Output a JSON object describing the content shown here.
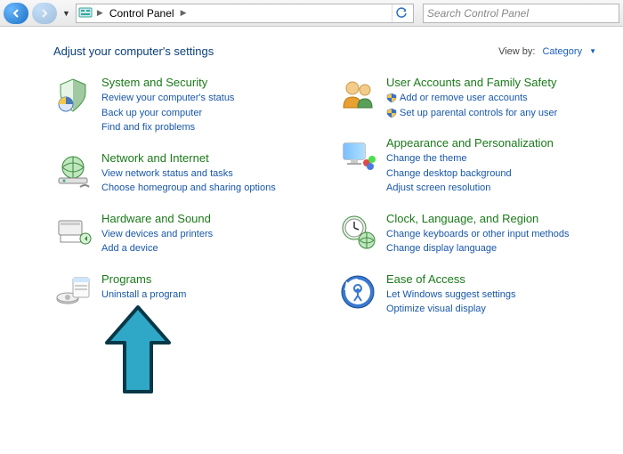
{
  "toolbar": {
    "breadcrumb_item": "Control Panel",
    "search_placeholder": "Search Control Panel"
  },
  "header": {
    "title": "Adjust your computer's settings",
    "viewby_label": "View by:",
    "viewby_value": "Category"
  },
  "left": [
    {
      "title": "System and Security",
      "links": [
        {
          "label": "Review your computer's status"
        },
        {
          "label": "Back up your computer"
        },
        {
          "label": "Find and fix problems"
        }
      ]
    },
    {
      "title": "Network and Internet",
      "links": [
        {
          "label": "View network status and tasks"
        },
        {
          "label": "Choose homegroup and sharing options"
        }
      ]
    },
    {
      "title": "Hardware and Sound",
      "links": [
        {
          "label": "View devices and printers"
        },
        {
          "label": "Add a device"
        }
      ]
    },
    {
      "title": "Programs",
      "links": [
        {
          "label": "Uninstall a program"
        }
      ]
    }
  ],
  "right": [
    {
      "title": "User Accounts and Family Safety",
      "links": [
        {
          "label": "Add or remove user accounts",
          "shield": true
        },
        {
          "label": "Set up parental controls for any user",
          "shield": true
        }
      ]
    },
    {
      "title": "Appearance and Personalization",
      "links": [
        {
          "label": "Change the theme"
        },
        {
          "label": "Change desktop background"
        },
        {
          "label": "Adjust screen resolution"
        }
      ]
    },
    {
      "title": "Clock, Language, and Region",
      "links": [
        {
          "label": "Change keyboards or other input methods"
        },
        {
          "label": "Change display language"
        }
      ]
    },
    {
      "title": "Ease of Access",
      "links": [
        {
          "label": "Let Windows suggest settings"
        },
        {
          "label": "Optimize visual display"
        }
      ]
    }
  ]
}
